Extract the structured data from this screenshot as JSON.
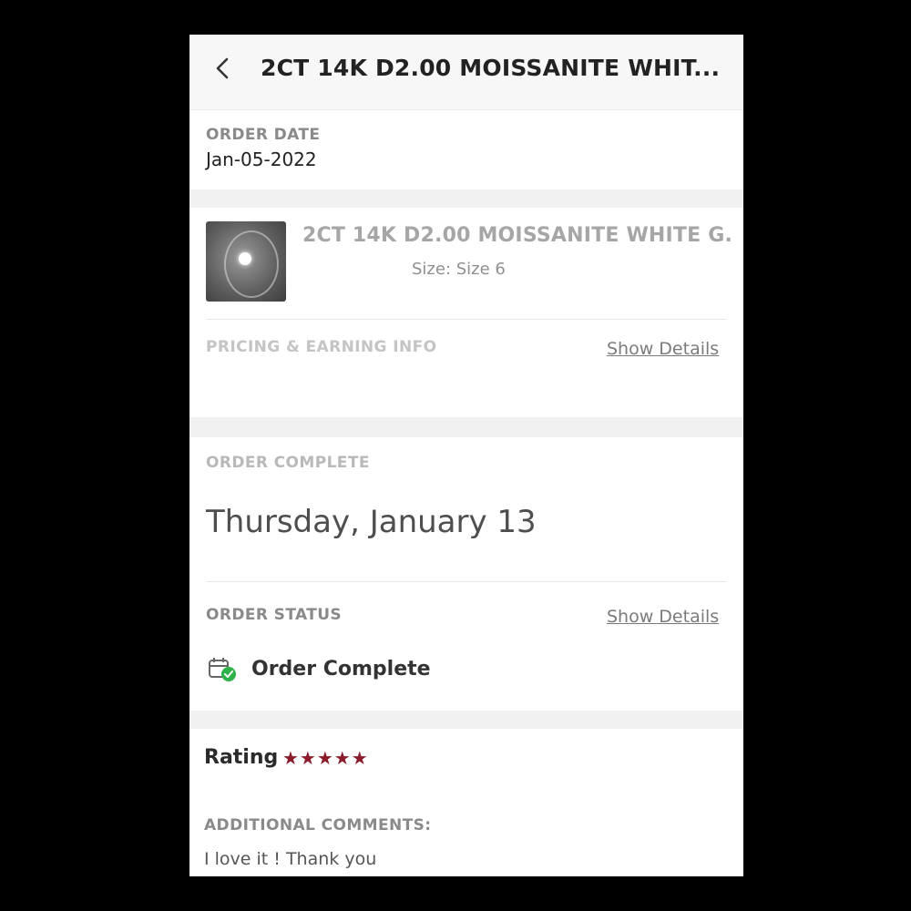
{
  "header": {
    "title": "2CT 14K D2.00 MOISSANITE WHIT..."
  },
  "order": {
    "date_label": "ORDER DATE",
    "date_value": "Jan-05-2022"
  },
  "product": {
    "title": "2CT 14K D2.00 MOISSANITE WHITE G...",
    "size": "Size: Size 6"
  },
  "pricing": {
    "label": "PRICING & EARNING INFO",
    "link": "Show Details"
  },
  "complete": {
    "label": "ORDER COMPLETE",
    "date": "Thursday, January 13"
  },
  "status": {
    "label": "ORDER STATUS",
    "link": "Show Details",
    "text": "Order Complete",
    "icon": "calendar-check-icon",
    "check_color": "#2db34a"
  },
  "rating": {
    "label": "Rating",
    "stars": "★★★★★",
    "value": 5,
    "max": 5,
    "color": "#8b1a2a"
  },
  "comments": {
    "label": "ADDITIONAL COMMENTS:",
    "text": "I love it ! Thank you"
  }
}
